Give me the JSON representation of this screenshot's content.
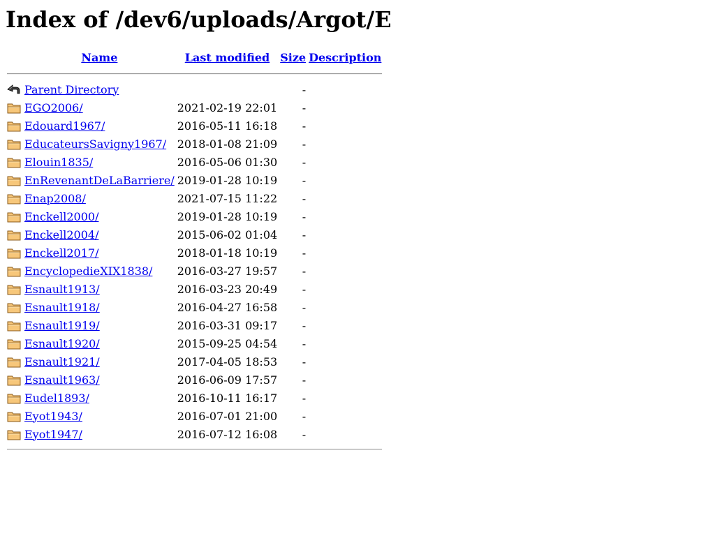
{
  "page": {
    "title": "Index of /dev6/uploads/Argot/E"
  },
  "columns": {
    "name": "Name",
    "last_modified": "Last modified",
    "size": "Size",
    "description": "Description"
  },
  "parent": {
    "label": "Parent Directory",
    "icon": "back-icon",
    "modified": "",
    "size": "-",
    "description": ""
  },
  "entries": [
    {
      "name": "EGO2006/",
      "modified": "2021-02-19 22:01",
      "size": "-",
      "icon": "folder-icon"
    },
    {
      "name": "Edouard1967/",
      "modified": "2016-05-11 16:18",
      "size": "-",
      "icon": "folder-icon"
    },
    {
      "name": "EducateursSavigny1967/",
      "modified": "2018-01-08 21:09",
      "size": "-",
      "icon": "folder-icon"
    },
    {
      "name": "Elouin1835/",
      "modified": "2016-05-06 01:30",
      "size": "-",
      "icon": "folder-icon"
    },
    {
      "name": "EnRevenantDeLaBarriere/",
      "modified": "2019-01-28 10:19",
      "size": "-",
      "icon": "folder-icon"
    },
    {
      "name": "Enap2008/",
      "modified": "2021-07-15 11:22",
      "size": "-",
      "icon": "folder-icon"
    },
    {
      "name": "Enckell2000/",
      "modified": "2019-01-28 10:19",
      "size": "-",
      "icon": "folder-icon"
    },
    {
      "name": "Enckell2004/",
      "modified": "2015-06-02 01:04",
      "size": "-",
      "icon": "folder-icon"
    },
    {
      "name": "Enckell2017/",
      "modified": "2018-01-18 10:19",
      "size": "-",
      "icon": "folder-icon"
    },
    {
      "name": "EncyclopedieXIX1838/",
      "modified": "2016-03-27 19:57",
      "size": "-",
      "icon": "folder-icon"
    },
    {
      "name": "Esnault1913/",
      "modified": "2016-03-23 20:49",
      "size": "-",
      "icon": "folder-icon"
    },
    {
      "name": "Esnault1918/",
      "modified": "2016-04-27 16:58",
      "size": "-",
      "icon": "folder-icon"
    },
    {
      "name": "Esnault1919/",
      "modified": "2016-03-31 09:17",
      "size": "-",
      "icon": "folder-icon"
    },
    {
      "name": "Esnault1920/",
      "modified": "2015-09-25 04:54",
      "size": "-",
      "icon": "folder-icon"
    },
    {
      "name": "Esnault1921/",
      "modified": "2017-04-05 18:53",
      "size": "-",
      "icon": "folder-icon"
    },
    {
      "name": "Esnault1963/",
      "modified": "2016-06-09 17:57",
      "size": "-",
      "icon": "folder-icon"
    },
    {
      "name": "Eudel1893/",
      "modified": "2016-10-11 16:17",
      "size": "-",
      "icon": "folder-icon"
    },
    {
      "name": "Eyot1943/",
      "modified": "2016-07-01 21:00",
      "size": "-",
      "icon": "folder-icon"
    },
    {
      "name": "Eyot1947/",
      "modified": "2016-07-12 16:08",
      "size": "-",
      "icon": "folder-icon"
    }
  ],
  "colors": {
    "link": "#0000ee",
    "folder_fill": "#f7c77a",
    "folder_stroke": "#8a5a1a",
    "rule": "#9a9a9a"
  }
}
